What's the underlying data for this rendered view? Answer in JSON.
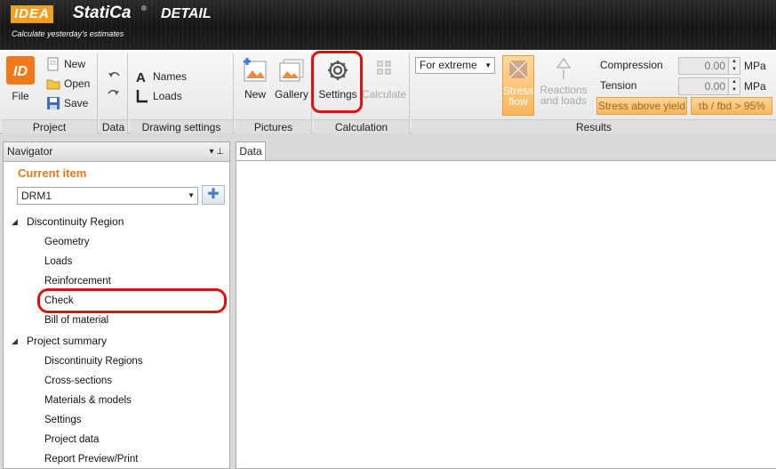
{
  "app": {
    "logo_idea": "IDEA",
    "logo_statica": "StatiCa",
    "logo_reg": "®",
    "product": "DETAIL",
    "tagline": "Calculate yesterday's estimates"
  },
  "ribbon": {
    "project": {
      "label": "Project",
      "file": "File",
      "new": "New",
      "open": "Open",
      "save": "Save"
    },
    "data": {
      "label": "Data"
    },
    "drawing_settings": {
      "label": "Drawing settings",
      "names": "Names",
      "loads": "Loads"
    },
    "pictures": {
      "label": "Pictures",
      "new": "New",
      "gallery": "Gallery"
    },
    "calculation": {
      "label": "Calculation",
      "settings": "Settings",
      "calculate": "Calculate"
    },
    "results": {
      "label": "Results",
      "mode": "For extreme",
      "stress_flow_1": "Stress",
      "stress_flow_2": "flow",
      "reactions_1": "Reactions",
      "reactions_2": "and loads",
      "compression": "Compression",
      "tension": "Tension",
      "compression_value": "0.00",
      "tension_value": "0.00",
      "unit": "MPa",
      "stress_above_yield": "Stress above yield",
      "bond_ratio": "τb / fbd > 95%"
    }
  },
  "navigator": {
    "title": "Navigator",
    "pin": "▾  ⊥",
    "current_item_label": "Current item",
    "current_item_value": "DRM1",
    "groups": [
      {
        "label": "Discontinuity Region",
        "items": [
          "Geometry",
          "Loads",
          "Reinforcement",
          "Check",
          "Bill of material"
        ]
      },
      {
        "label": "Project summary",
        "items": [
          "Discontinuity Regions",
          "Cross-sections",
          "Materials & models",
          "Settings",
          "Project data",
          "Report Preview/Print"
        ]
      }
    ]
  },
  "main": {
    "tab": "Data"
  },
  "colors": {
    "accent_orange": "#e07b1e",
    "highlight_red": "#e01010",
    "logo_orange": "#f0a020"
  }
}
